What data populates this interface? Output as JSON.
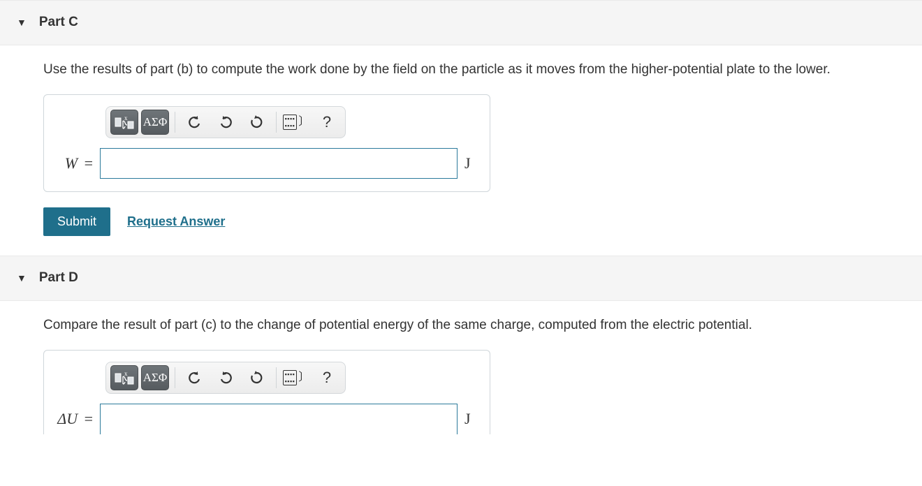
{
  "parts": [
    {
      "title": "Part C",
      "question": "Use the results of part (b) to compute the work done by the field on the particle as it moves from the higher-potential plate to the lower.",
      "variable_html": "<i>W</i> <span class='op'>=</span>",
      "unit": "J",
      "input_value": "",
      "show_actions": true
    },
    {
      "title": "Part D",
      "question": "Compare the result of part (c) to the change of potential energy of the same charge, computed from the electric potential.",
      "variable_html": "Δ<i>U</i> <span class='op'>=</span>",
      "unit": "J",
      "input_value": "",
      "show_actions": false
    }
  ],
  "toolbar": {
    "greek_label": "ΑΣΦ",
    "help_label": "?"
  },
  "actions": {
    "submit": "Submit",
    "request": "Request Answer"
  }
}
